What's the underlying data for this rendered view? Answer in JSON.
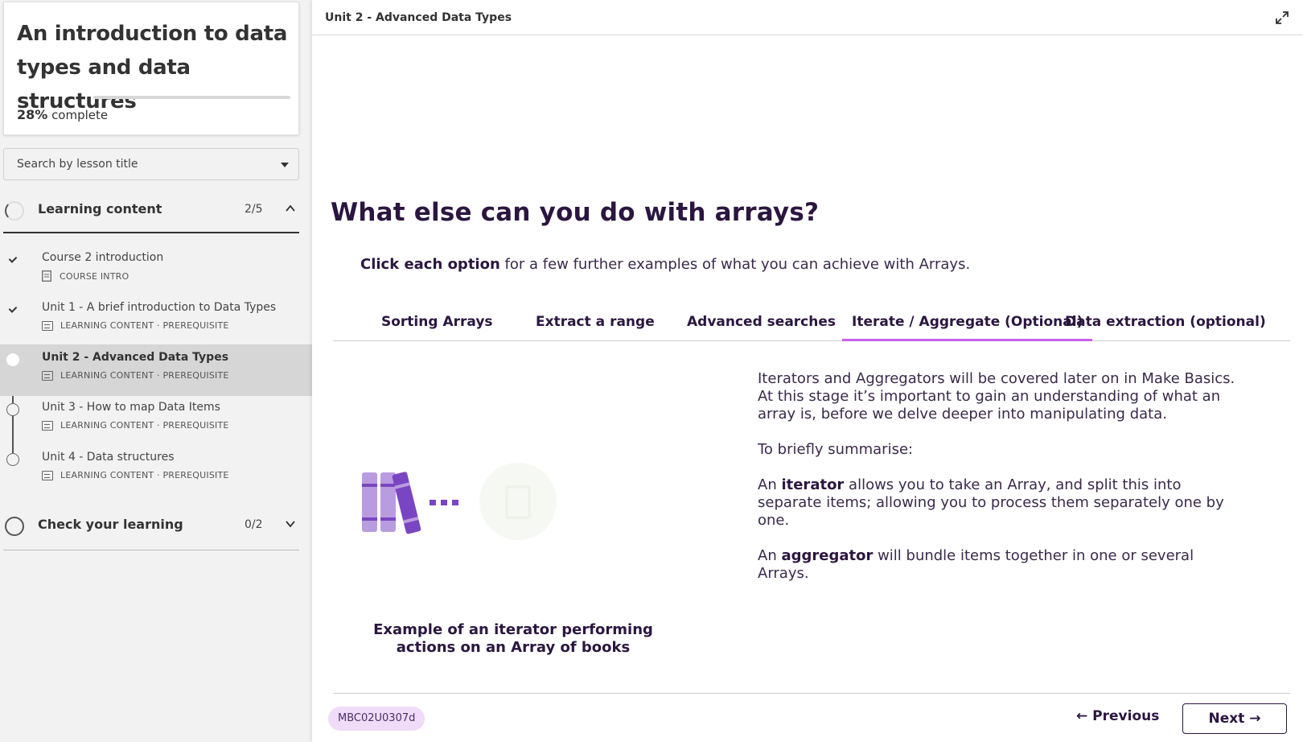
{
  "sidebar": {
    "course_title": "An introduction to data types and data structures",
    "progress_percent": "28%",
    "progress_label": " complete",
    "progress_value": 0.28,
    "search_placeholder": "Search by lesson title",
    "sections": [
      {
        "label": "Learning content",
        "count": "2/5",
        "expanded": true,
        "lessons": [
          {
            "title": "Course 2 introduction",
            "meta": "COURSE INTRO",
            "status": "complete"
          },
          {
            "title": "Unit 1 - A brief introduction to Data Types",
            "meta": "LEARNING CONTENT · PREREQUISITE",
            "status": "complete"
          },
          {
            "title": "Unit 2 - Advanced Data Types",
            "meta": "LEARNING CONTENT · PREREQUISITE",
            "status": "current"
          },
          {
            "title": "Unit 3 - How to map Data Items",
            "meta": "LEARNING CONTENT · PREREQUISITE",
            "status": "not-started"
          },
          {
            "title": "Unit 4 - Data structures",
            "meta": "LEARNING CONTENT · PREREQUISITE",
            "status": "not-started"
          }
        ]
      },
      {
        "label": "Check your learning",
        "count": "0/2",
        "expanded": false
      }
    ]
  },
  "main": {
    "breadcrumb": "Unit 2 - Advanced Data Types",
    "heading": "What else can you do with arrays?",
    "intro_bold": "Click each option",
    "intro_rest": " for a few further examples of what you can achieve with Arrays.",
    "tabs": [
      {
        "label": "Sorting Arrays"
      },
      {
        "label": "Extract a range"
      },
      {
        "label": "Advanced searches"
      },
      {
        "label": "Iterate / Aggregate (Optional)",
        "active": true
      },
      {
        "label": "Data extraction (optional)"
      }
    ],
    "caption": "Example of an iterator performing actions on an Array of books",
    "panel": {
      "p1": "Iterators and Aggregators will be covered later on in Make Basics. At this stage it’s important to gain an understanding of what an array is, before we delve deeper into manipulating data.",
      "p2": "To briefly summarise:",
      "p3_pre": "An ",
      "p3_bold": "iterator",
      "p3_post": " allows you to take an Array, and split this into separate items; allowing you to process them separately one by one.",
      "p4_pre": "An ",
      "p4_bold": "aggregator",
      "p4_post": " will bundle items together in one or several Arrays."
    }
  },
  "footer": {
    "tag": "MBC02U0307d",
    "prev_label": "← Previous",
    "next_label": "Next →"
  },
  "colors": {
    "accent": "#c760ea",
    "brand_dark": "#2b1640",
    "illustration_purple": "#7a45c2",
    "illustration_light": "#b99ce0",
    "tag_bg": "#f0dcf8"
  },
  "icons": [
    "check-icon",
    "lesson-card-icon",
    "document-icon",
    "chevron-up-icon",
    "chevron-down-icon",
    "expand-icon",
    "caret-down-icon",
    "arrow-left-icon",
    "arrow-right-icon"
  ]
}
